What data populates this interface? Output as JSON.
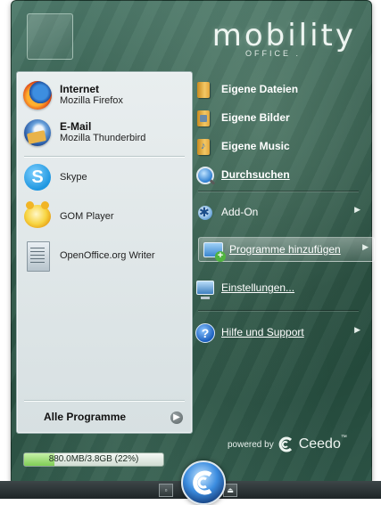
{
  "brand": {
    "name": "mobility",
    "sub": "OFFICE ."
  },
  "left_panel": {
    "items": [
      {
        "title": "Internet",
        "subtitle": "Mozilla Firefox",
        "icon": "firefox-icon"
      },
      {
        "title": "E-Mail",
        "subtitle": "Mozilla Thunderbird",
        "icon": "thunderbird-icon"
      },
      {
        "label": "Skype",
        "icon": "skype-icon"
      },
      {
        "label": "GOM Player",
        "icon": "gom-player-icon"
      },
      {
        "label": "OpenOffice.org Writer",
        "icon": "openoffice-writer-icon"
      }
    ],
    "all_programs": "Alle Programme"
  },
  "right_panel": {
    "items": [
      {
        "label": "Eigene Dateien",
        "icon": "folder-icon"
      },
      {
        "label": "Eigene Bilder",
        "icon": "pictures-folder-icon"
      },
      {
        "label": "Eigene Music",
        "icon": "music-folder-icon"
      },
      {
        "label": "Durchsuchen",
        "icon": "search-icon"
      },
      {
        "label": "Add-On",
        "icon": "addon-icon"
      },
      {
        "label": "Programme hinzufügen",
        "icon": "add-programs-icon"
      },
      {
        "label": "Einstellungen...",
        "icon": "settings-icon"
      },
      {
        "label": "Hilfe und Support",
        "icon": "help-icon"
      }
    ]
  },
  "footer": {
    "powered_by": "powered by",
    "vendor": "Ceedo",
    "trademark": "™",
    "storage_text": "880.0MB/3.8GB (22%)",
    "storage_fraction": 0.22
  },
  "colors": {
    "panel_green": "#2d5546",
    "storage_green": "#7fcd55",
    "orb_blue": "#3c8de0"
  }
}
